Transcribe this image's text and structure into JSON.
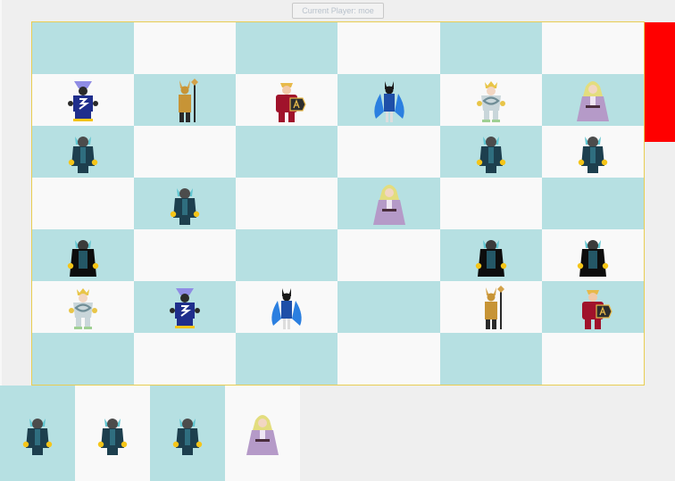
{
  "status": {
    "current_player_text": "Current Player: moe"
  },
  "colors": {
    "board_teal": "#b6e0e2",
    "board_white": "#f9f9f9",
    "board_border": "#e8cd52",
    "side_panel": "#ff0000",
    "page_background": "#efefef"
  },
  "board": {
    "rows": 7,
    "cols": 6,
    "pieces": [
      [
        null,
        null,
        null,
        null,
        null,
        null
      ],
      [
        "blue-masked-hero",
        "golden-staff-warrior",
        "red-shield-hero",
        "blue-winged-bat-hero",
        "silver-crowned-knight",
        "violet-sorceress"
      ],
      [
        "teal-horned-guard",
        null,
        null,
        null,
        "teal-horned-guard",
        "teal-horned-guard"
      ],
      [
        null,
        "teal-horned-guard",
        null,
        "violet-sorceress",
        null,
        null
      ],
      [
        "black-caped-guard",
        null,
        null,
        null,
        "black-caped-guard",
        "black-caped-guard"
      ],
      [
        "silver-crowned-knight",
        "blue-masked-hero",
        "blue-winged-bat-hero",
        null,
        "golden-staff-warrior",
        "red-shield-hero"
      ],
      [
        null,
        null,
        null,
        null,
        null,
        null
      ]
    ]
  },
  "bench": {
    "pieces": [
      "teal-horned-guard",
      "teal-horned-guard",
      "teal-horned-guard",
      "violet-sorceress"
    ]
  }
}
